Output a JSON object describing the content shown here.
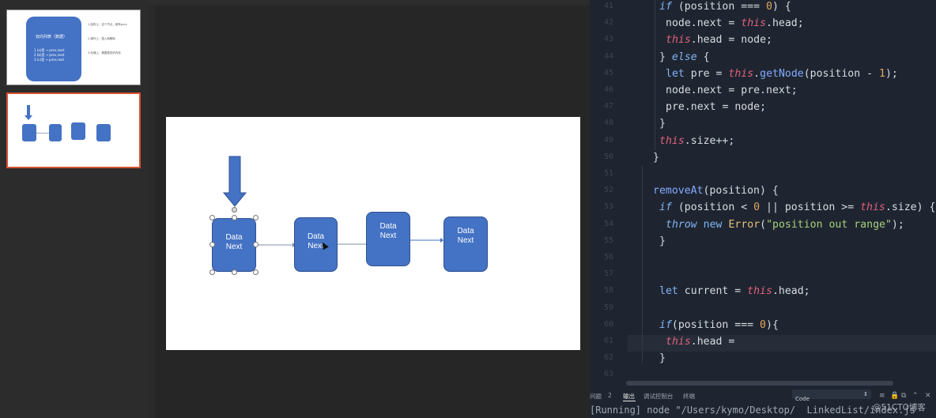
{
  "slides": {
    "thumb1": {
      "card_title": "双向列表（数据）",
      "card_lines": [
        "1  (a)是  → prev,next",
        "2  (b)是  → prev,next",
        "3  (c)是  → prev,next"
      ],
      "notes": [
        "1.结构上：这个节点，都有prev",
        "2.操作上：插入和删除",
        "3.存储上：需要更多的内存"
      ]
    },
    "thumb2": {
      "node_labels": [
        "Data\nNext",
        "Data\nNext",
        "Data\nNext",
        "Data\nNext"
      ]
    },
    "canvas": {
      "nodes": [
        {
          "line1": "Data",
          "line2": "Next"
        },
        {
          "line1": "Data",
          "line2": "Next"
        },
        {
          "line1": "Data",
          "line2": "Next"
        },
        {
          "line1": "Data",
          "line2": "Next"
        }
      ]
    },
    "accent": "#d35230",
    "node_color": "#4472c4"
  },
  "code": {
    "line_numbers": [
      "41",
      "42",
      "43",
      "44",
      "45",
      "46",
      "47",
      "48",
      "49",
      "50",
      "51",
      "52",
      "53",
      "54",
      "55",
      "56",
      "57",
      "58",
      "59",
      "60",
      "61",
      "62",
      "63"
    ],
    "lines": [
      "if (position === 0) {",
      "node.next = this.head;",
      "this.head = node;",
      "} else {",
      "let pre = this.getNode(position - 1);",
      "node.next = pre.next;",
      "pre.next = node;",
      "}",
      "this.size++;",
      "}",
      "",
      "removeAt(position) {",
      "if (position < 0 || position >= this.size) {",
      "throw new Error(\"position out range\");",
      "}",
      "",
      "",
      "let current = this.head;",
      "",
      "if(position === 0){",
      "this.head =",
      "}",
      ""
    ]
  },
  "panel": {
    "tabs": [
      "问题",
      "2",
      "输出",
      "调试控制台",
      "终端"
    ],
    "select_value": "Code",
    "terminal_text": "[Running] node \"/Users/kymo/Desktop/  LinkedList/index.js"
  },
  "watermark": "@51CTO博客"
}
